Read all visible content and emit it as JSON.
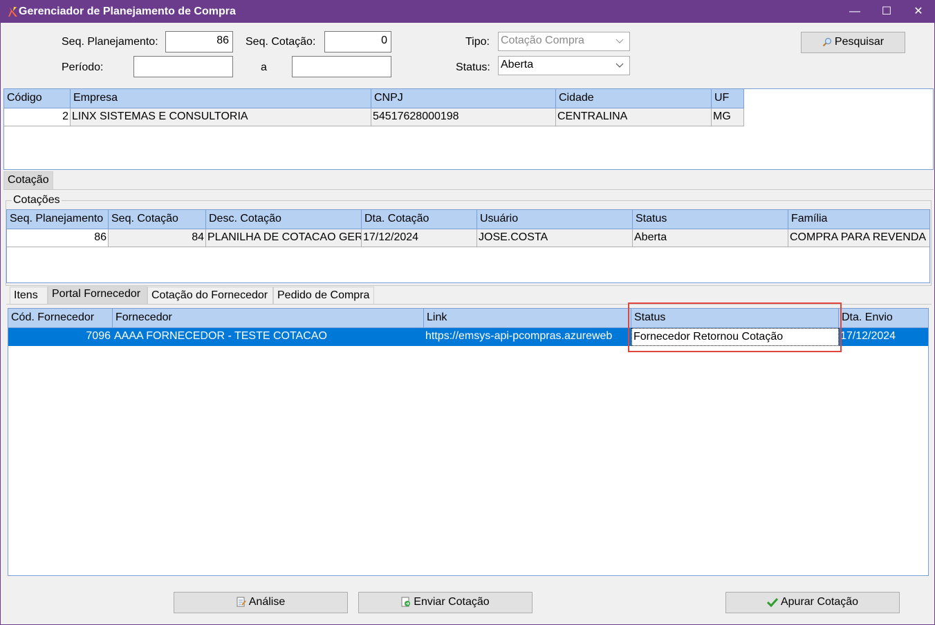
{
  "window": {
    "title": "Gerenciador de Planejamento de Compra",
    "controls": {
      "minimize": "—",
      "maximize": "☐",
      "close": "✕"
    }
  },
  "filters": {
    "seq_planejamento_label": "Seq. Planejamento:",
    "seq_planejamento_value": "86",
    "seq_cotacao_label": "Seq. Cotação:",
    "seq_cotacao_value": "0",
    "tipo_label": "Tipo:",
    "tipo_value": "Cotação Compra",
    "periodo_label": "Período:",
    "periodo_start": "",
    "periodo_sep": "a",
    "periodo_end": "",
    "status_label": "Status:",
    "status_value": "Aberta",
    "search_button": "Pesquisar"
  },
  "companies": {
    "columns": [
      "Código",
      "Empresa",
      "CNPJ",
      "Cidade",
      "UF"
    ],
    "rows": [
      {
        "codigo": "2",
        "empresa": "LINX SISTEMAS E CONSULTORIA",
        "cnpj": "54517628000198",
        "cidade": "CENTRALINA",
        "uf": "MG"
      }
    ]
  },
  "outer_tab": {
    "label": "Cotação"
  },
  "quotations": {
    "caption": "Cotações",
    "columns": [
      "Seq. Planejamento",
      "Seq. Cotação",
      "Desc. Cotação",
      "Dta. Cotação",
      "Usuário",
      "Status",
      "Família"
    ],
    "rows": [
      {
        "seq_planejamento": "86",
        "seq_cotacao": "84",
        "desc": "PLANILHA DE COTACAO GER",
        "data": "17/12/2024",
        "usuario": "JOSE.COSTA",
        "status": "Aberta",
        "familia": "COMPRA PARA REVENDA"
      }
    ]
  },
  "inner_tabs": [
    {
      "label": "Itens"
    },
    {
      "label": "Portal Fornecedor",
      "active": true
    },
    {
      "label": "Cotação do Fornecedor"
    },
    {
      "label": "Pedido de Compra"
    }
  ],
  "suppliers": {
    "columns": [
      "Cód. Fornecedor",
      "Fornecedor",
      "Link",
      "Status",
      "Dta. Envio"
    ],
    "rows": [
      {
        "codigo": "7096",
        "fornecedor": "AAAA FORNECEDOR - TESTE COTACAO",
        "link": "https://emsys-api-pcompras.azureweb",
        "status": "Fornecedor Retornou Cotação",
        "data_envio": "17/12/2024"
      }
    ]
  },
  "footer": {
    "analise_button": "Análise",
    "enviar_button": "Enviar Cotação",
    "apurar_button": "Apurar Cotação"
  },
  "colors": {
    "titlebar": "#6b3c8c",
    "grid_header": "#b7d1f2",
    "selection": "#0078d7",
    "highlight": "#e0443a"
  }
}
